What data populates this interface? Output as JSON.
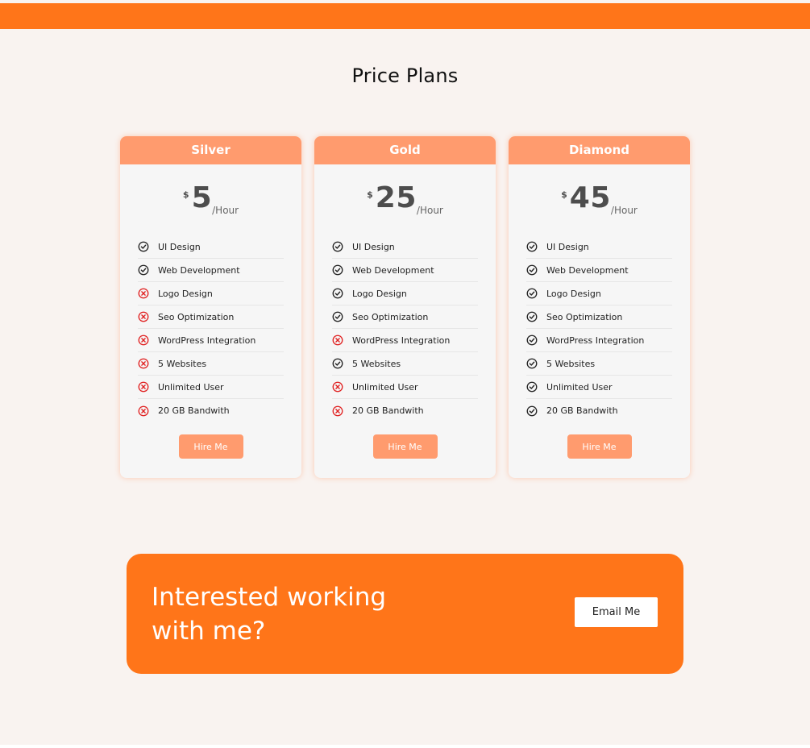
{
  "header": {
    "accent_color": "#ff7519"
  },
  "section": {
    "title": "Price Plans"
  },
  "icons": {
    "included": "check-circle-icon",
    "excluded": "x-circle-icon"
  },
  "colors": {
    "card_header": "#ff9b6e",
    "included": "#222222",
    "excluded": "#e02020"
  },
  "plans": [
    {
      "name": "Silver",
      "currency": "$",
      "price": "5",
      "unit": "/Hour",
      "features": [
        {
          "label": "UI Design",
          "included": true
        },
        {
          "label": "Web Development",
          "included": true
        },
        {
          "label": "Logo Design",
          "included": false
        },
        {
          "label": "Seo Optimization",
          "included": false
        },
        {
          "label": "WordPress Integration",
          "included": false
        },
        {
          "label": "5 Websites",
          "included": false
        },
        {
          "label": "Unlimited User",
          "included": false
        },
        {
          "label": "20 GB Bandwith",
          "included": false
        }
      ],
      "button": "Hire Me"
    },
    {
      "name": "Gold",
      "currency": "$",
      "price": "25",
      "unit": "/Hour",
      "features": [
        {
          "label": "UI Design",
          "included": true
        },
        {
          "label": "Web Development",
          "included": true
        },
        {
          "label": "Logo Design",
          "included": true
        },
        {
          "label": "Seo Optimization",
          "included": true
        },
        {
          "label": "WordPress Integration",
          "included": false
        },
        {
          "label": "5 Websites",
          "included": true
        },
        {
          "label": "Unlimited User",
          "included": false
        },
        {
          "label": "20 GB Bandwith",
          "included": false
        }
      ],
      "button": "Hire Me"
    },
    {
      "name": "Diamond",
      "currency": "$",
      "price": "45",
      "unit": "/Hour",
      "features": [
        {
          "label": "UI Design",
          "included": true
        },
        {
          "label": "Web Development",
          "included": true
        },
        {
          "label": "Logo Design",
          "included": true
        },
        {
          "label": "Seo Optimization",
          "included": true
        },
        {
          "label": "WordPress Integration",
          "included": true
        },
        {
          "label": "5 Websites",
          "included": true
        },
        {
          "label": "Unlimited User",
          "included": true
        },
        {
          "label": "20 GB Bandwith",
          "included": true
        }
      ],
      "button": "Hire Me"
    }
  ],
  "cta": {
    "text": "Interested working with me?",
    "button": "Email Me"
  }
}
